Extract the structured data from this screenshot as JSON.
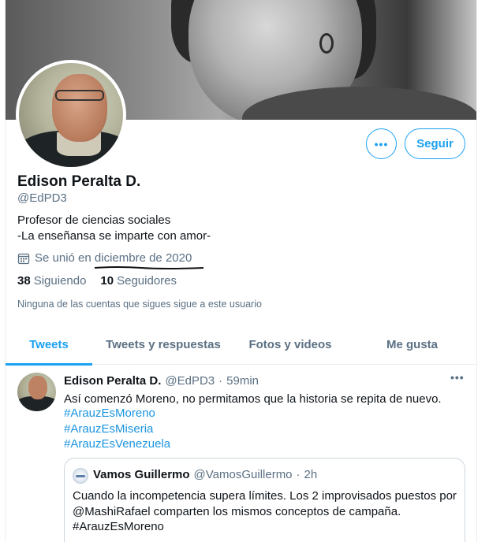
{
  "profile": {
    "name": "Edison Peralta D.",
    "handle": "@EdPD3",
    "bio_line1": "Profesor de ciencias sociales",
    "bio_line2": "-La enseñansa se imparte con amor-",
    "joined": "Se unió en diciembre de 2020",
    "following_count": "38",
    "following_label": "Siguiendo",
    "followers_count": "10",
    "followers_label": "Seguidores",
    "note": "Ninguna de las cuentas que sigues sigue a este usuario"
  },
  "actions": {
    "more_label": "•••",
    "follow_label": "Seguir"
  },
  "tabs": [
    {
      "label": "Tweets",
      "active": true
    },
    {
      "label": "Tweets y respuestas",
      "active": false
    },
    {
      "label": "Fotos y videos",
      "active": false
    },
    {
      "label": "Me gusta",
      "active": false
    }
  ],
  "tweet": {
    "author_name": "Edison Peralta D.",
    "author_handle": "@EdPD3",
    "separator": "·",
    "time": "59min",
    "more_label": "•••",
    "text": "Así comenzó Moreno, no permitamos que la historia se repita de nuevo.",
    "hashtags": [
      "#ArauzEsMoreno",
      "#ArauzEsMiseria",
      "#ArauzEsVenezuela"
    ],
    "quote": {
      "author_name": "Vamos Guillermo",
      "author_handle": "@VamosGuillermo",
      "separator": "·",
      "time": "2h",
      "line1": "Cuando la incompetencia supera límites. Los 2 improvisados puestos por",
      "line2": "@MashiRafael comparten los mismos conceptos de campaña.",
      "line3": "#ArauzEsMoreno"
    }
  },
  "colors": {
    "accent": "#1da1f2",
    "text_primary": "#0f1419",
    "text_secondary": "#5b7083",
    "border": "#ebeef0"
  },
  "icons": {
    "calendar": "calendar-icon",
    "more": "more-horizontal-icon"
  }
}
